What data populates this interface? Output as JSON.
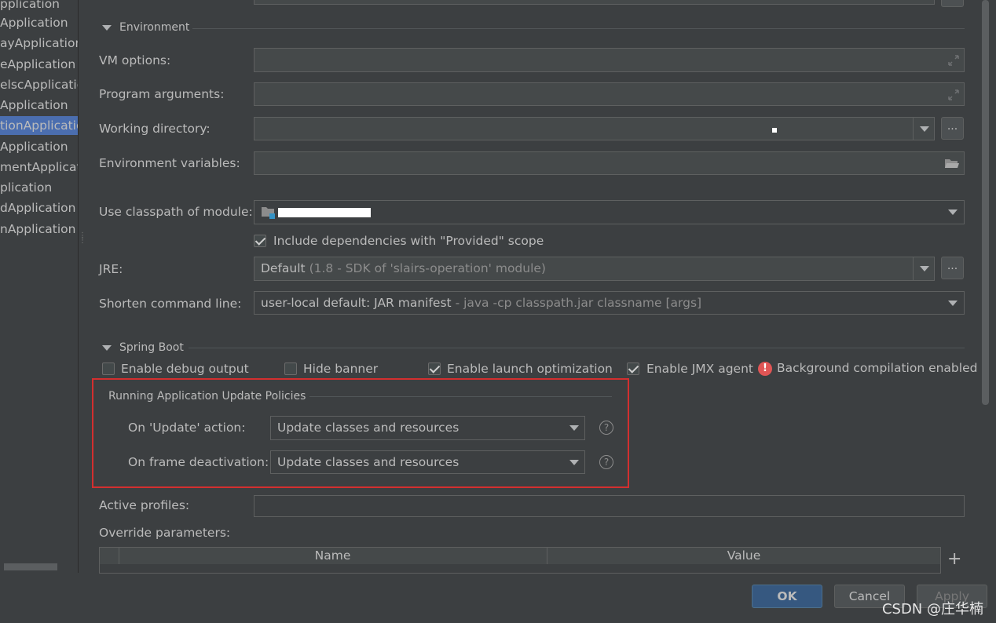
{
  "left_list": {
    "items": [
      {
        "label": "pplication",
        "selected": false
      },
      {
        "label": "Application",
        "selected": false
      },
      {
        "label": "ayApplication",
        "selected": false
      },
      {
        "label": "eApplication",
        "selected": false
      },
      {
        "label": "elscApplicatio",
        "selected": false
      },
      {
        "label": "Application",
        "selected": false
      },
      {
        "label": "tionApplicatio",
        "selected": true
      },
      {
        "label": "Application",
        "selected": false
      },
      {
        "label": "mentApplicat",
        "selected": false
      },
      {
        "label": "plication",
        "selected": false
      },
      {
        "label": "dApplication",
        "selected": false
      },
      {
        "label": "nApplication",
        "selected": false
      }
    ]
  },
  "environment": {
    "section_title": "Environment",
    "vm_options_label": "VM options:",
    "vm_options_value": "",
    "program_arguments_label": "Program arguments:",
    "program_arguments_value": "",
    "working_directory_label": "Working directory:",
    "working_directory_value": "",
    "environment_variables_label": "Environment variables:",
    "environment_variables_value": "",
    "browse_button_label": "...",
    "expand_icon": "expand-icon",
    "folder_icon": "folder-open-icon"
  },
  "classpath": {
    "label": "Use classpath of module:",
    "module_icon": "module-folder-icon",
    "include_provided_label": "Include dependencies with \"Provided\" scope",
    "include_provided_checked": true
  },
  "jre": {
    "label": "JRE:",
    "value": "Default",
    "detail": "(1.8 - SDK of 'slairs-operation' module)",
    "browse_button_label": "..."
  },
  "shorten": {
    "label": "Shorten command line:",
    "value": "user-local default: JAR manifest",
    "detail": "- java -cp classpath.jar classname [args]"
  },
  "spring_boot": {
    "section_title": "Spring Boot",
    "enable_debug_output": {
      "label": "Enable debug output",
      "checked": false
    },
    "hide_banner": {
      "label": "Hide banner",
      "checked": false
    },
    "enable_launch_optimization": {
      "label": "Enable launch optimization",
      "checked": true
    },
    "enable_jmx_agent": {
      "label": "Enable JMX agent",
      "checked": true
    },
    "background_compilation": {
      "label": "Background compilation enabled",
      "icon": "error-icon"
    }
  },
  "update_policies": {
    "title": "Running Application Update Policies",
    "on_update_label": "On 'Update' action:",
    "on_update_value": "Update classes and resources",
    "on_frame_label": "On frame deactivation:",
    "on_frame_value": "Update classes and resources",
    "help_glyph": "?"
  },
  "profiles": {
    "active_profiles_label": "Active profiles:",
    "active_profiles_value": "",
    "override_parameters_label": "Override parameters:",
    "table_columns": [
      "Name",
      "Value"
    ],
    "add_button_label": "+"
  },
  "buttons": {
    "ok": "OK",
    "cancel": "Cancel",
    "apply": "Apply"
  },
  "watermark": "CSDN @庄华楠",
  "colors": {
    "background": "#3c3f41",
    "field": "#45494a",
    "selection": "#4b6eaf",
    "highlight_box": "#d32f2f",
    "ok_button": "#365880",
    "error": "#e05555"
  }
}
